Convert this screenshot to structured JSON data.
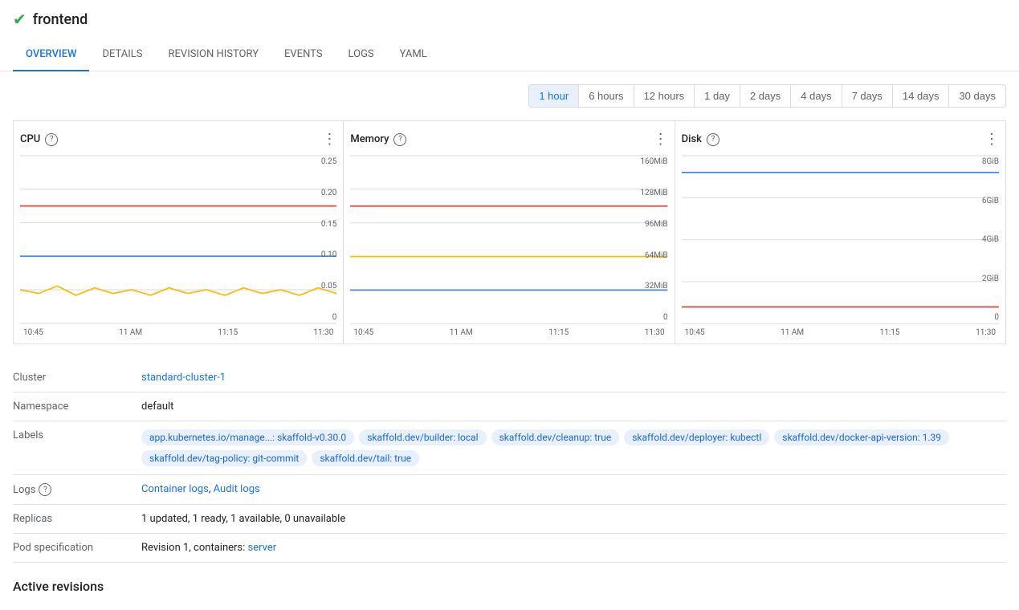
{
  "header": {
    "title": "frontend",
    "status": "active"
  },
  "tabs": [
    {
      "id": "overview",
      "label": "OVERVIEW",
      "active": true
    },
    {
      "id": "details",
      "label": "DETAILS",
      "active": false
    },
    {
      "id": "revision-history",
      "label": "REVISION HISTORY",
      "active": false
    },
    {
      "id": "events",
      "label": "EVENTS",
      "active": false
    },
    {
      "id": "logs",
      "label": "LOGS",
      "active": false
    },
    {
      "id": "yaml",
      "label": "YAML",
      "active": false
    }
  ],
  "time_selector": {
    "options": [
      "1 hour",
      "6 hours",
      "12 hours",
      "1 day",
      "2 days",
      "4 days",
      "7 days",
      "14 days",
      "30 days"
    ],
    "active": "1 hour"
  },
  "charts": {
    "cpu": {
      "title": "CPU",
      "x_labels": [
        "10:45",
        "11 AM",
        "11:15",
        "11:30"
      ],
      "y_labels": [
        "0.25",
        "0.20",
        "0.15",
        "0.10",
        "0.05",
        "0"
      ]
    },
    "memory": {
      "title": "Memory",
      "x_labels": [
        "10:45",
        "11 AM",
        "11:15",
        "11:30"
      ],
      "y_labels": [
        "160MiB",
        "128MiB",
        "96MiB",
        "64MiB",
        "32MiB",
        "0"
      ]
    },
    "disk": {
      "title": "Disk",
      "x_labels": [
        "10:45",
        "11 AM",
        "11:15",
        "11:30"
      ],
      "y_labels": [
        "8GiB",
        "6GiB",
        "4GiB",
        "2GiB",
        "0"
      ]
    }
  },
  "info": {
    "cluster": {
      "label": "Cluster",
      "value": "standard-cluster-1",
      "link": true
    },
    "namespace": {
      "label": "Namespace",
      "value": "default"
    },
    "labels": {
      "label": "Labels",
      "chips": [
        "app.kubernetes.io/manage...: skaffold-v0.30.0",
        "skaffold.dev/builder: local",
        "skaffold.dev/cleanup: true",
        "skaffold.dev/deployer: kubectl",
        "skaffold.dev/docker-api-version: 1.39",
        "skaffold.dev/tag-policy: git-commit",
        "skaffold.dev/tail: true"
      ]
    },
    "logs": {
      "label": "Logs",
      "container_logs": "Container logs",
      "audit_logs": "Audit logs"
    },
    "replicas": {
      "label": "Replicas",
      "value": "1 updated, 1 ready, 1 available, 0 unavailable"
    },
    "pod_spec": {
      "label": "Pod specification",
      "prefix": "Revision 1, containers: ",
      "server_link": "server"
    }
  },
  "active_revisions": {
    "title": "Active revisions"
  }
}
